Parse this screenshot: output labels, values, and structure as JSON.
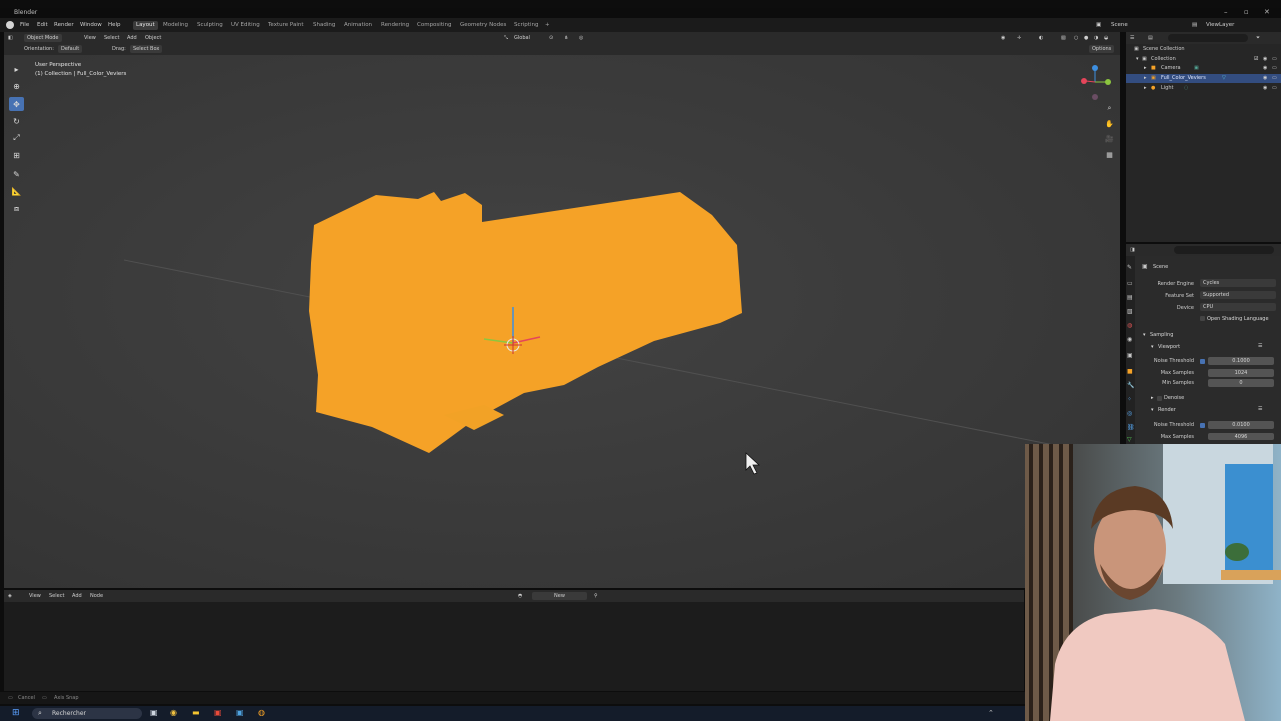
{
  "window": {
    "title": "Blender"
  },
  "menu": {
    "items": [
      "File",
      "Edit",
      "Render",
      "Window",
      "Help"
    ],
    "workspaces": [
      "Layout",
      "Modeling",
      "Sculpting",
      "UV Editing",
      "Texture Paint",
      "Shading",
      "Animation",
      "Rendering",
      "Compositing",
      "Geometry Nodes",
      "Scripting"
    ],
    "active_workspace": "Layout",
    "add_symbol": "+",
    "scene": "Scene",
    "view_layer": "ViewLayer"
  },
  "viewport_header": {
    "mode": "Object Mode",
    "menus": [
      "View",
      "Select",
      "Add",
      "Object"
    ],
    "transform": "Global",
    "options": "Options"
  },
  "tool_header": {
    "orientation_label": "Orientation:",
    "orientation_value": "Default",
    "drag_label": "Drag:",
    "drag_value": "Select Box"
  },
  "viewport": {
    "view_name": "User Perspective",
    "collection_info": "(1) Collection | Full_Color_Veviers",
    "object_color": "#f5a227",
    "background": "#3d3d3d"
  },
  "gizmo": {
    "x_color": "#e5455a",
    "y_color": "#8cc63f",
    "z_color": "#3d8fe0"
  },
  "node_editor": {
    "menus": [
      "View",
      "Select",
      "Add",
      "Node"
    ],
    "new_button": "New"
  },
  "status_bar": {
    "items": [
      "Cancel",
      "Axis Snap"
    ]
  },
  "taskbar": {
    "search": "Rechercher"
  },
  "outliner": {
    "items": [
      {
        "label": "Scene Collection",
        "indent": 0,
        "selected": false
      },
      {
        "label": "Collection",
        "indent": 1,
        "selected": false
      },
      {
        "label": "Camera",
        "indent": 2,
        "selected": false
      },
      {
        "label": "Full_Color_Veviers",
        "indent": 2,
        "selected": true
      },
      {
        "label": "Light",
        "indent": 2,
        "selected": false
      }
    ]
  },
  "properties": {
    "scene_label": "Scene",
    "render_engine_label": "Render Engine",
    "render_engine": "Cycles",
    "feature_set_label": "Feature Set",
    "feature_set": "Supported",
    "device_label": "Device",
    "device": "CPU",
    "osl_label": "Open Shading Language",
    "sampling": "Sampling",
    "viewport_section": "Viewport",
    "noise_threshold_label": "Noise Threshold",
    "viewport_noise_threshold": "0.1000",
    "max_samples_label": "Max Samples",
    "viewport_max_samples": "1024",
    "min_samples_label": "Min Samples",
    "viewport_min_samples": "0",
    "denoise": "Denoise",
    "render_section": "Render",
    "render_noise_threshold": "0.0100",
    "render_max_samples": "4096"
  }
}
